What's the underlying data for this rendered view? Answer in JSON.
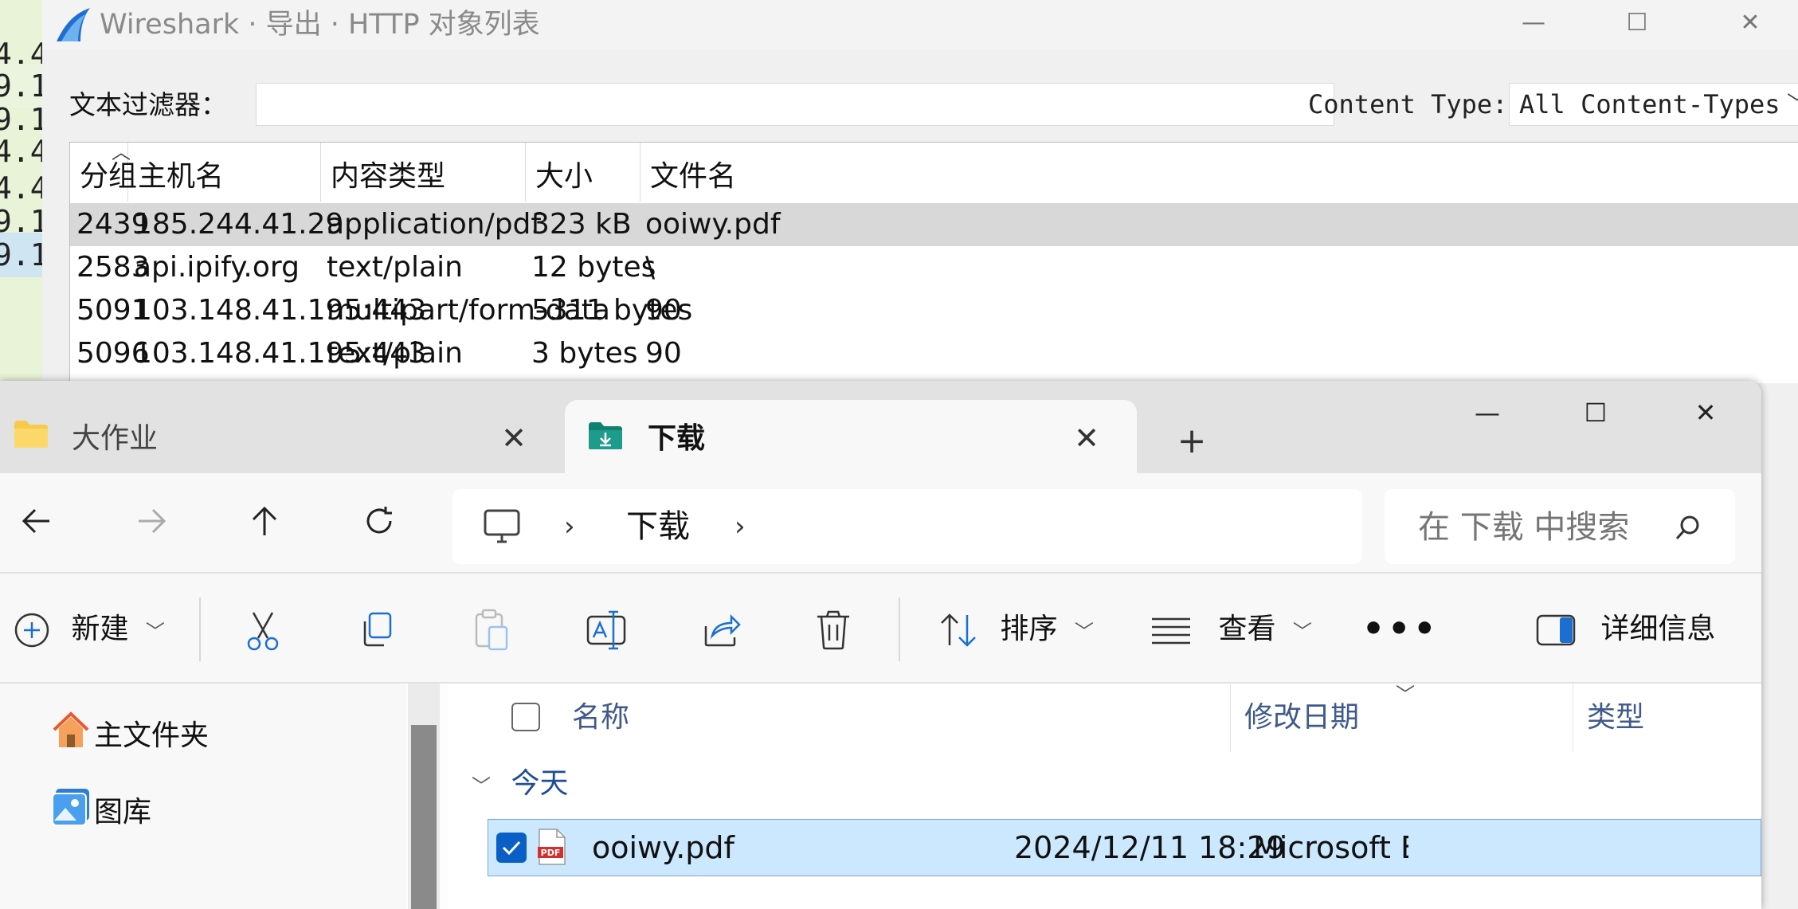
{
  "background_rows": [
    "4.4",
    "9.1",
    "9.1",
    "4.4",
    "4.4",
    "9.1",
    "9.1"
  ],
  "wireshark": {
    "title": "Wireshark · 导出 · HTTP 对象列表",
    "filter_label": "文本过滤器：",
    "filter_value": "",
    "content_type_label": "Content Type:",
    "content_type_value": "All Content-Types",
    "columns": [
      "分组",
      "主机名",
      "内容类型",
      "大小",
      "文件名"
    ],
    "rows": [
      [
        "2439",
        "185.244.41.29",
        "application/pdf",
        "323 kB",
        "ooiwy.pdf"
      ],
      [
        "2583",
        "api.ipify.org",
        "text/plain",
        "12 bytes",
        "\\"
      ],
      [
        "5091",
        "103.148.41.195:443",
        "multipart/form-data",
        "5311 bytes",
        "90"
      ],
      [
        "5096",
        "103.148.41.195:443",
        "text/plain",
        "3 bytes",
        "90"
      ]
    ]
  },
  "explorer": {
    "tabs": [
      "大作业",
      "下载"
    ],
    "breadcrumb": [
      "下载"
    ],
    "search_placeholder": "在 下载 中搜索",
    "commands": {
      "new": "新建",
      "sort": "排序",
      "view": "查看",
      "details": "详细信息"
    },
    "nav_items": [
      "主文件夹",
      "图库"
    ],
    "columns": [
      "名称",
      "修改日期",
      "类型"
    ],
    "group_label": "今天",
    "file": {
      "name": "ooiwy.pdf",
      "modified": "2024/12/11 18:29",
      "type": "Microsoft Edge PDF Document"
    },
    "colors": {
      "selection": "#cce8ff",
      "accent": "#0a5fc7",
      "folder": "#f8c94a",
      "downloads": "#1d9c8c",
      "pdf": "#d32f2f"
    }
  }
}
